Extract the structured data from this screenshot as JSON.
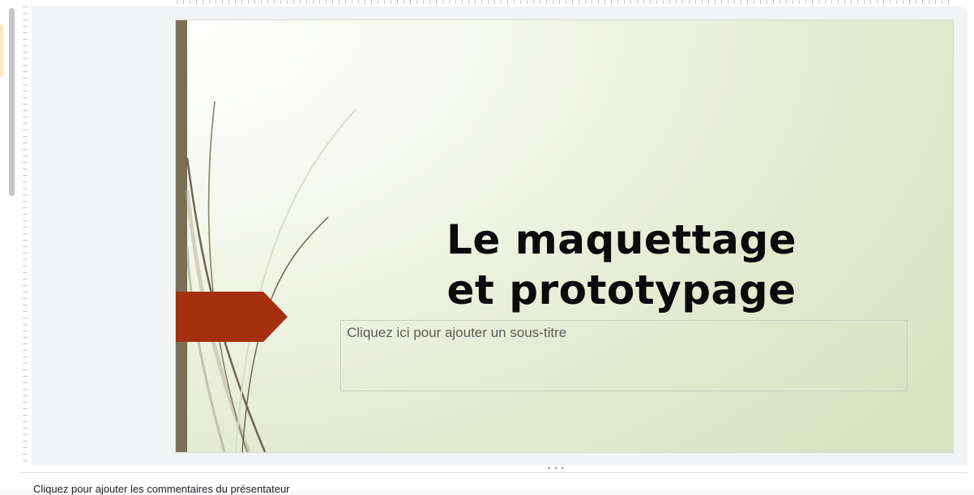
{
  "slide": {
    "title": "Le maquettage\net prototypage",
    "subtitle_placeholder": "Cliquez ici pour ajouter un sous-titre"
  },
  "notes": {
    "placeholder": "Cliquez pour ajouter les commentaires du présentateur"
  },
  "colors": {
    "accent_bar": "#7a6f55",
    "arrow": "#a5300f"
  },
  "icons": {
    "drag_handle": "more-horiz-icon"
  }
}
